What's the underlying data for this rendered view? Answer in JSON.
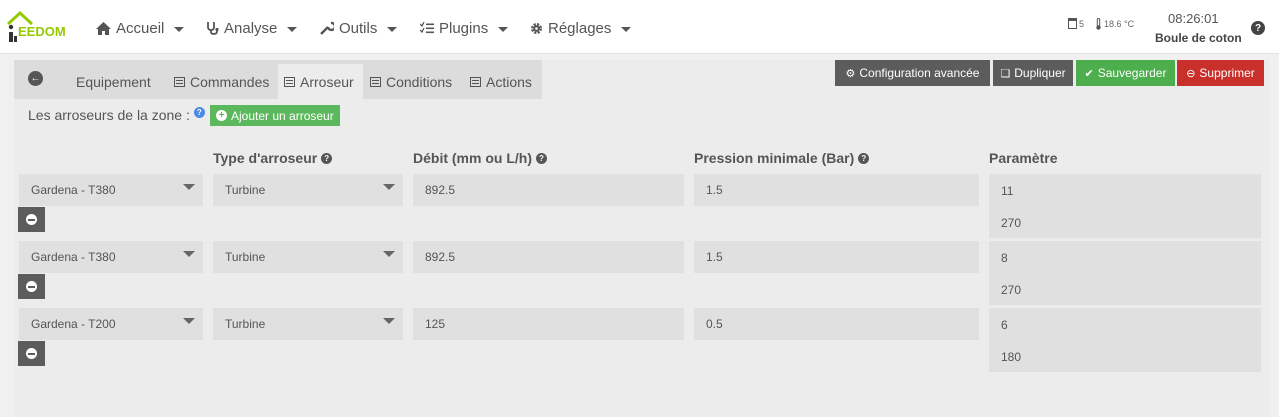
{
  "navbar": {
    "logo": "EEDOM",
    "menu": [
      {
        "label": "Accueil",
        "icon": "home-icon"
      },
      {
        "label": "Analyse",
        "icon": "stethoscope-icon"
      },
      {
        "label": "Outils",
        "icon": "wrench-icon"
      },
      {
        "label": "Plugins",
        "icon": "tasks-icon"
      },
      {
        "label": "Réglages",
        "icon": "cog-icon"
      }
    ],
    "window_count": "5",
    "temperature": "18.6 °C",
    "time": "08:26:01",
    "user": "Boule de coton"
  },
  "tabs": [
    {
      "label": "Equipement",
      "icon": ""
    },
    {
      "label": "Commandes",
      "icon": "list-icon"
    },
    {
      "label": "Arroseur",
      "icon": "list-icon",
      "active": true
    },
    {
      "label": "Conditions",
      "icon": "list-icon"
    },
    {
      "label": "Actions",
      "icon": "list-icon"
    }
  ],
  "actions": {
    "config": "Configuration avancée",
    "duplicate": "Dupliquer",
    "save": "Sauvegarder",
    "delete": "Supprimer"
  },
  "zone": {
    "label": "Les arroseurs de la zone :",
    "add_button": "Ajouter un arroseur"
  },
  "columns": {
    "type": "Type d'arroseur",
    "debit": "Débit (mm ou L/h)",
    "pression": "Pression minimale (Bar)",
    "parametre": "Paramètre"
  },
  "rows": [
    {
      "model": "Gardena - T380",
      "type": "Turbine",
      "debit": "892.5",
      "pression": "1.5",
      "param1": "11",
      "param2": "270"
    },
    {
      "model": "Gardena - T380",
      "type": "Turbine",
      "debit": "892.5",
      "pression": "1.5",
      "param1": "8",
      "param2": "270"
    },
    {
      "model": "Gardena - T200",
      "type": "Turbine",
      "debit": "125",
      "pression": "0.5",
      "param1": "6",
      "param2": "180"
    }
  ]
}
